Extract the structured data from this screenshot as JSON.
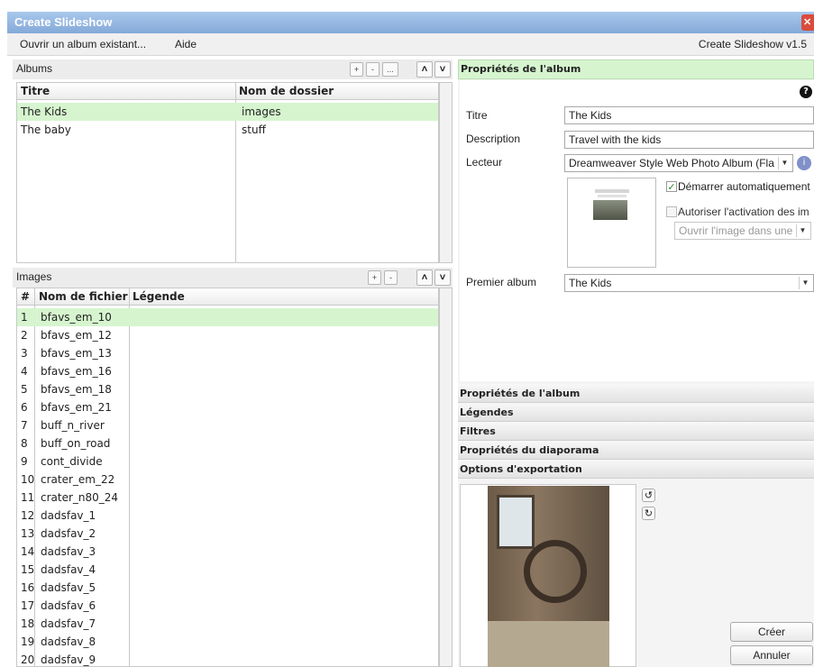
{
  "window": {
    "title": "Create Slideshow"
  },
  "menu": {
    "open_album": "Ouvrir un album existant...",
    "help": "Aide",
    "version": "Create Slideshow v1.5"
  },
  "albums": {
    "header": "Albums",
    "buttons": {
      "add": "+",
      "remove": "-",
      "more": "..."
    },
    "columns": [
      "Titre",
      "Nom de dossier"
    ],
    "rows": [
      {
        "title": "The Kids",
        "folder": "images"
      },
      {
        "title": "The baby",
        "folder": "stuff"
      }
    ]
  },
  "images": {
    "header": "Images",
    "buttons": {
      "add": "+",
      "remove": "-"
    },
    "columns": [
      "#",
      "Nom de fichier",
      "Légende"
    ],
    "rows": [
      {
        "n": "1",
        "file": "bfavs_em_10"
      },
      {
        "n": "2",
        "file": "bfavs_em_12"
      },
      {
        "n": "3",
        "file": "bfavs_em_13"
      },
      {
        "n": "4",
        "file": "bfavs_em_16"
      },
      {
        "n": "5",
        "file": "bfavs_em_18"
      },
      {
        "n": "6",
        "file": "bfavs_em_21"
      },
      {
        "n": "7",
        "file": "buff_n_river"
      },
      {
        "n": "8",
        "file": "buff_on_road"
      },
      {
        "n": "9",
        "file": "cont_divide"
      },
      {
        "n": "10",
        "file": "crater_em_22"
      },
      {
        "n": "11",
        "file": "crater_n80_24"
      },
      {
        "n": "12",
        "file": "dadsfav_1"
      },
      {
        "n": "13",
        "file": "dadsfav_2"
      },
      {
        "n": "14",
        "file": "dadsfav_3"
      },
      {
        "n": "15",
        "file": "dadsfav_4"
      },
      {
        "n": "16",
        "file": "dadsfav_5"
      },
      {
        "n": "17",
        "file": "dadsfav_6"
      },
      {
        "n": "18",
        "file": "dadsfav_7"
      },
      {
        "n": "19",
        "file": "dadsfav_8"
      },
      {
        "n": "20",
        "file": "dadsfav_9"
      }
    ]
  },
  "props": {
    "header": "Propriétés de l'album",
    "help_icon": "question-icon",
    "title_label": "Titre",
    "title_value": "The Kids",
    "desc_label": "Description",
    "desc_value": "Travel with the kids",
    "player_label": "Lecteur",
    "player_value": "Dreamweaver Style Web Photo Album (Fla",
    "autostart_label": "Démarrer automatiquement",
    "allow_label": "Autoriser l'activation des im",
    "open_image_value": "Ouvrir l'image dans une",
    "first_album_label": "Premier album",
    "first_album_value": "The Kids"
  },
  "sections": [
    "Propriétés de l'album",
    "Légendes",
    "Filtres",
    "Propriétés du diaporama",
    "Options d'exportation"
  ],
  "actions": {
    "create": "Créer",
    "cancel": "Annuler"
  },
  "colors": {
    "title_bar": "#84a9d8",
    "selection": "#d6f5cf",
    "close": "#d94b3b"
  }
}
